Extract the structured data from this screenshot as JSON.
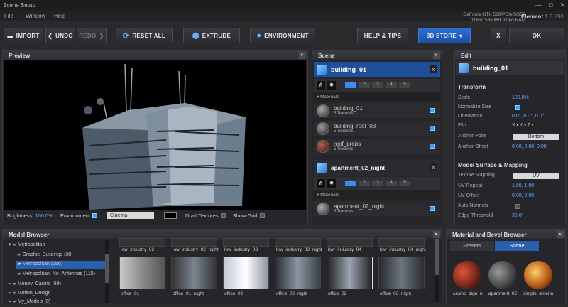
{
  "window": {
    "title": "Scene Setup"
  },
  "menu": [
    "File",
    "Window",
    "Help"
  ],
  "gpu": {
    "line1": "GeForce GTX 580/PCIe/SSE2",
    "line2": "1165/1536 MB Video RAM"
  },
  "element_label": "Element",
  "element_version": "1.5.290",
  "toolbar": {
    "import": "IMPORT",
    "undo": "UNDO",
    "redo": "REDO",
    "reset": "RESET ALL",
    "extrude": "EXTRUDE",
    "environment": "ENVIRONMENT",
    "help": "HELP & TIPS",
    "store": "3D STORE",
    "close": "X",
    "ok": "OK"
  },
  "preview": {
    "title": "Preview",
    "brightness_label": "Brightness",
    "brightness_value": "100.0%",
    "environment_label": "Environment",
    "environment_value": "Cinema",
    "draft_label": "Draft Textures",
    "grid_label": "Show Grid"
  },
  "scene": {
    "title": "Scene",
    "obj1": "building_01",
    "obj2": "apartment_02_night",
    "tabs": [
      "1",
      "2",
      "3",
      "4",
      "5"
    ],
    "materials_label": "Materials",
    "mats1": [
      {
        "name": "building_01",
        "sub": "5 Textures"
      },
      {
        "name": "building_roof_03",
        "sub": "5 Textures"
      },
      {
        "name": "roof_props",
        "sub": "5 Textures"
      }
    ],
    "mats2": [
      {
        "name": "apartment_02_night",
        "sub": "5 Textures"
      }
    ]
  },
  "edit": {
    "title": "Edit",
    "object": "building_01",
    "transform": "Transform",
    "scale_l": "Scale",
    "scale_v": "100.0%",
    "norm_l": "Normalize Size",
    "orient_l": "Orientation",
    "orient_v": "0.0°, 0.0°, 0.0°",
    "flip_l": "Flip",
    "flip_v": "X  ▪  Y  ▪  Z  ▪",
    "anchor_l": "Anchor Point",
    "anchor_v": "Bottom",
    "offset_l": "Anchor Offset",
    "offset_v": "0.00, 0.00, 0.00",
    "surface": "Model Surface & Mapping",
    "tex_l": "Texture Mapping",
    "tex_v": "UV",
    "uvr_l": "UV Repeat",
    "uvr_v": "1.00, 1.00",
    "uvo_l": "UV Offset",
    "uvo_v": "0.00, 0.00",
    "auto_l": "Auto Normals",
    "edge_l": "Edge Threshold",
    "edge_v": "35.0°"
  },
  "browser": {
    "title": "Model Browser",
    "tree": [
      "Metropolitan",
      "Graphic_Buildings (30)",
      "Metropolitan (156)",
      "Metropolitan_No_Antennas (115)",
      "Money_Casino (60)",
      "Motion_Design",
      "My_Models (0)"
    ],
    "row1": [
      "low_industry_02",
      "low_industry_02_night",
      "low_industry_03",
      "low_industry_03_night",
      "low_industry_04",
      "low_industry_04_night"
    ],
    "row2": [
      "office_01",
      "office_01_night",
      "office_02",
      "office_02_night",
      "office_02",
      "office_03_night"
    ]
  },
  "matbrowser": {
    "title": "Material and Bevel Browser",
    "tab1": "Presets",
    "tab2": "Scene",
    "items": [
      "casino_sign_n",
      "apartment_02",
      "simple_antenn"
    ]
  }
}
